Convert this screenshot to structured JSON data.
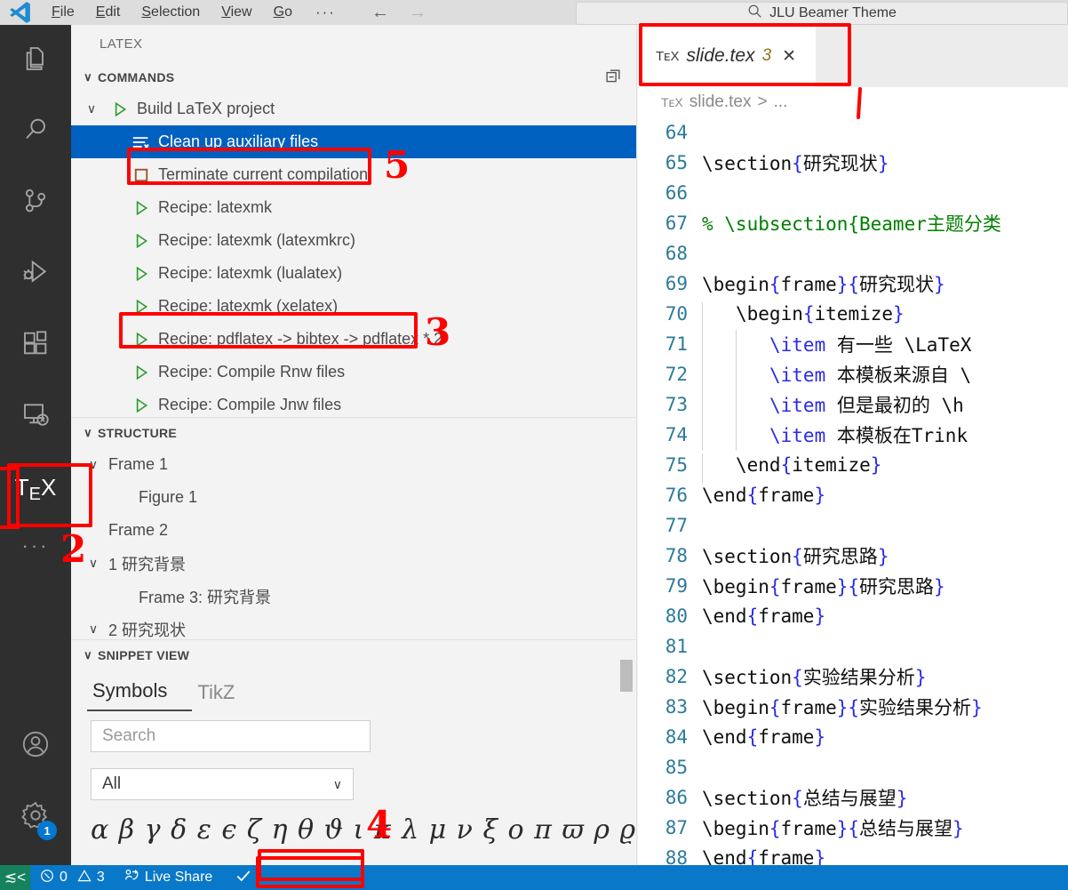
{
  "titlebar": {
    "logo_icon": "vscode-logo-icon",
    "menus": [
      {
        "label": "File",
        "mnemonic": "F"
      },
      {
        "label": "Edit",
        "mnemonic": "E"
      },
      {
        "label": "Selection",
        "mnemonic": "S"
      },
      {
        "label": "View",
        "mnemonic": "V"
      },
      {
        "label": "Go",
        "mnemonic": "G"
      }
    ],
    "overflow_label": "···",
    "back_icon": "arrow-left-icon",
    "forward_icon": "arrow-right-icon",
    "command_center": {
      "search_icon": "search-icon",
      "text": "JLU Beamer Theme"
    }
  },
  "activitybar": {
    "items": [
      {
        "name": "explorer",
        "icon": "files-icon",
        "active": false
      },
      {
        "name": "search",
        "icon": "search-icon",
        "active": false
      },
      {
        "name": "source-control",
        "icon": "source-control-icon",
        "active": false
      },
      {
        "name": "run-and-debug",
        "icon": "run-debug-icon",
        "active": false
      },
      {
        "name": "extensions",
        "icon": "extensions-icon",
        "active": false
      },
      {
        "name": "remote-explorer",
        "icon": "remote-explorer-icon",
        "active": false
      },
      {
        "name": "latex-workshop",
        "icon": "tex-icon",
        "label": "TeX",
        "active": true
      }
    ],
    "more_label": "···",
    "account_icon": "account-icon",
    "settings_icon": "gear-icon",
    "settings_badge": "1"
  },
  "sidebar": {
    "title": "LATEX",
    "commands": {
      "header": "COMMANDS",
      "collapse_icon": "collapse-all-icon",
      "chevron": "∨",
      "items": [
        {
          "label": "Build LaTeX project",
          "icon": "play-icon",
          "twisty": "∨",
          "indent": 0,
          "selected": false
        },
        {
          "label": "Clean up auxiliary files",
          "icon": "clear-all-icon",
          "twisty": "",
          "indent": 1,
          "selected": true
        },
        {
          "label": "Terminate current compilation",
          "icon": "stop-square-icon",
          "twisty": "",
          "indent": 1,
          "selected": false
        },
        {
          "label": "Recipe: latexmk",
          "icon": "play-icon",
          "twisty": "",
          "indent": 1,
          "selected": false
        },
        {
          "label": "Recipe: latexmk (latexmkrc)",
          "icon": "play-icon",
          "twisty": "",
          "indent": 1,
          "selected": false
        },
        {
          "label": "Recipe: latexmk (lualatex)",
          "icon": "play-icon",
          "twisty": "",
          "indent": 1,
          "selected": false
        },
        {
          "label": "Recipe: latexmk (xelatex)",
          "icon": "play-icon",
          "twisty": "",
          "indent": 1,
          "selected": false
        },
        {
          "label": "Recipe: pdflatex -> bibtex -> pdflatex * 2",
          "icon": "play-icon",
          "twisty": "",
          "indent": 1,
          "selected": false
        },
        {
          "label": "Recipe: Compile Rnw files",
          "icon": "play-icon",
          "twisty": "",
          "indent": 1,
          "selected": false
        },
        {
          "label": "Recipe: Compile Jnw files",
          "icon": "play-icon",
          "twisty": "",
          "indent": 1,
          "selected": false
        }
      ]
    },
    "structure": {
      "header": "STRUCTURE",
      "chevron": "∨",
      "items": [
        {
          "label": "Frame 1",
          "twisty": "∨",
          "indent": 0
        },
        {
          "label": "Figure 1",
          "twisty": "",
          "indent": 1
        },
        {
          "label": "Frame 2",
          "twisty": "",
          "indent": 0
        },
        {
          "label": "1 研究背景",
          "twisty": "∨",
          "indent": 0
        },
        {
          "label": "Frame 3: 研究背景",
          "twisty": "",
          "indent": 1
        },
        {
          "label": "2 研究现状",
          "twisty": "∨",
          "indent": 0
        }
      ]
    },
    "snippet": {
      "header": "SNIPPET VIEW",
      "chevron": "∨",
      "tabs": [
        {
          "label": "Symbols",
          "active": true
        },
        {
          "label": "TikZ",
          "active": false
        }
      ],
      "search_placeholder": "Search",
      "search_value": "",
      "filter_selected": "All",
      "filter_caret": "∨",
      "symbols_row": "α β γ δ ε ϵ ζ η θ ϑ ι κ λ μ ν ξ ο π ϖ ρ ϱ"
    }
  },
  "editor": {
    "tab": {
      "icon": "tex-file-icon",
      "icon_label": "TᴇX",
      "filename": "slide.tex",
      "problem_count": "3",
      "close_icon": "close-icon"
    },
    "breadcrumb": {
      "icon_label": "TᴇX",
      "file": "slide.tex",
      "separator": ">",
      "ellipsis": "..."
    },
    "first_line_number": 64,
    "lines": [
      {
        "num": "64",
        "segments": []
      },
      {
        "num": "65",
        "segments": [
          {
            "t": "\\section",
            "c": "cmd"
          },
          {
            "t": "{",
            "c": "brace"
          },
          {
            "t": "研究现状",
            "c": "cjk"
          },
          {
            "t": "}",
            "c": "brace"
          }
        ],
        "indent": 0
      },
      {
        "num": "66",
        "segments": []
      },
      {
        "num": "67",
        "segments": [
          {
            "t": "% \\subsection{Beamer主题分类",
            "c": "cmt"
          }
        ],
        "indent": 0
      },
      {
        "num": "68",
        "segments": []
      },
      {
        "num": "69",
        "segments": [
          {
            "t": "\\begin",
            "c": "cmd"
          },
          {
            "t": "{",
            "c": "brace"
          },
          {
            "t": "frame",
            "c": "cmd"
          },
          {
            "t": "}{",
            "c": "brace"
          },
          {
            "t": "研究现状",
            "c": "cjk"
          },
          {
            "t": "}",
            "c": "brace"
          }
        ],
        "indent": 0
      },
      {
        "num": "70",
        "segments": [
          {
            "t": "\\begin",
            "c": "cmd"
          },
          {
            "t": "{",
            "c": "brace"
          },
          {
            "t": "itemize",
            "c": "cmd"
          },
          {
            "t": "}",
            "c": "brace"
          }
        ],
        "indent": 1
      },
      {
        "num": "71",
        "segments": [
          {
            "t": "\\item",
            "c": "item"
          },
          {
            "t": " ",
            "c": "cmd"
          },
          {
            "t": "有一些",
            "c": "cjk"
          },
          {
            "t": " \\LaTeX",
            "c": "cmd"
          }
        ],
        "indent": 2
      },
      {
        "num": "72",
        "segments": [
          {
            "t": "\\item",
            "c": "item"
          },
          {
            "t": " ",
            "c": "cmd"
          },
          {
            "t": "本模板来源自",
            "c": "cjk"
          },
          {
            "t": " \\",
            "c": "cmd"
          }
        ],
        "indent": 2
      },
      {
        "num": "73",
        "segments": [
          {
            "t": "\\item",
            "c": "item"
          },
          {
            "t": " ",
            "c": "cmd"
          },
          {
            "t": "但是最初的",
            "c": "cjk"
          },
          {
            "t": " \\h",
            "c": "cmd"
          }
        ],
        "indent": 2
      },
      {
        "num": "74",
        "segments": [
          {
            "t": "\\item",
            "c": "item"
          },
          {
            "t": " ",
            "c": "cmd"
          },
          {
            "t": "本模板在",
            "c": "cjk"
          },
          {
            "t": "Trink",
            "c": "cmd"
          }
        ],
        "indent": 2
      },
      {
        "num": "75",
        "segments": [
          {
            "t": "\\end",
            "c": "cmd"
          },
          {
            "t": "{",
            "c": "brace"
          },
          {
            "t": "itemize",
            "c": "cmd"
          },
          {
            "t": "}",
            "c": "brace"
          }
        ],
        "indent": 1
      },
      {
        "num": "76",
        "segments": [
          {
            "t": "\\end",
            "c": "cmd"
          },
          {
            "t": "{",
            "c": "brace"
          },
          {
            "t": "frame",
            "c": "cmd"
          },
          {
            "t": "}",
            "c": "brace"
          }
        ],
        "indent": 0
      },
      {
        "num": "77",
        "segments": []
      },
      {
        "num": "78",
        "segments": [
          {
            "t": "\\section",
            "c": "cmd"
          },
          {
            "t": "{",
            "c": "brace"
          },
          {
            "t": "研究思路",
            "c": "cjk"
          },
          {
            "t": "}",
            "c": "brace"
          }
        ],
        "indent": 0
      },
      {
        "num": "79",
        "segments": [
          {
            "t": "\\begin",
            "c": "cmd"
          },
          {
            "t": "{",
            "c": "brace"
          },
          {
            "t": "frame",
            "c": "cmd"
          },
          {
            "t": "}{",
            "c": "brace"
          },
          {
            "t": "研究思路",
            "c": "cjk"
          },
          {
            "t": "}",
            "c": "brace"
          }
        ],
        "indent": 0
      },
      {
        "num": "80",
        "segments": [
          {
            "t": "\\end",
            "c": "cmd"
          },
          {
            "t": "{",
            "c": "brace"
          },
          {
            "t": "frame",
            "c": "cmd"
          },
          {
            "t": "}",
            "c": "brace"
          }
        ],
        "indent": 0
      },
      {
        "num": "81",
        "segments": []
      },
      {
        "num": "82",
        "segments": [
          {
            "t": "\\section",
            "c": "cmd"
          },
          {
            "t": "{",
            "c": "brace"
          },
          {
            "t": "实验结果分析",
            "c": "cjk"
          },
          {
            "t": "}",
            "c": "brace"
          }
        ],
        "indent": 0
      },
      {
        "num": "83",
        "segments": [
          {
            "t": "\\begin",
            "c": "cmd"
          },
          {
            "t": "{",
            "c": "brace"
          },
          {
            "t": "frame",
            "c": "cmd"
          },
          {
            "t": "}{",
            "c": "brace"
          },
          {
            "t": "实验结果分析",
            "c": "cjk"
          },
          {
            "t": "}",
            "c": "brace"
          }
        ],
        "indent": 0
      },
      {
        "num": "84",
        "segments": [
          {
            "t": "\\end",
            "c": "cmd"
          },
          {
            "t": "{",
            "c": "brace"
          },
          {
            "t": "frame",
            "c": "cmd"
          },
          {
            "t": "}",
            "c": "brace"
          }
        ],
        "indent": 0
      },
      {
        "num": "85",
        "segments": []
      },
      {
        "num": "86",
        "segments": [
          {
            "t": "\\section",
            "c": "cmd"
          },
          {
            "t": "{",
            "c": "brace"
          },
          {
            "t": "总结与展望",
            "c": "cjk"
          },
          {
            "t": "}",
            "c": "brace"
          }
        ],
        "indent": 0
      },
      {
        "num": "87",
        "segments": [
          {
            "t": "\\begin",
            "c": "cmd"
          },
          {
            "t": "{",
            "c": "brace"
          },
          {
            "t": "frame",
            "c": "cmd"
          },
          {
            "t": "}{",
            "c": "brace"
          },
          {
            "t": "总结与展望",
            "c": "cjk"
          },
          {
            "t": "}",
            "c": "brace"
          }
        ],
        "indent": 0
      },
      {
        "num": "88",
        "segments": [
          {
            "t": "\\end",
            "c": "cmd"
          },
          {
            "t": "{",
            "c": "brace"
          },
          {
            "t": "frame",
            "c": "cmd"
          },
          {
            "t": "}",
            "c": "brace"
          }
        ],
        "indent": 0
      }
    ]
  },
  "statusbar": {
    "remote_icon": "remote-indicator-icon",
    "errors_icon": "error-icon",
    "errors": "0",
    "warnings_icon": "warning-icon",
    "warnings": "3",
    "liveshare_icon": "live-share-icon",
    "liveshare_label": "Live Share",
    "check_icon": "check-icon"
  },
  "annotations": {
    "color": "#ff0000",
    "marks": [
      {
        "id": "tab-highlight",
        "label": ""
      },
      {
        "id": "clean-up-highlight",
        "label": "5"
      },
      {
        "id": "xelatex-highlight",
        "label": "3"
      },
      {
        "id": "tex-icon-highlight",
        "label": "2"
      },
      {
        "id": "symbols-highlight",
        "label": "4"
      },
      {
        "id": "status-check-highlight",
        "label": ""
      },
      {
        "id": "structure-bracket",
        "label": ""
      }
    ]
  }
}
